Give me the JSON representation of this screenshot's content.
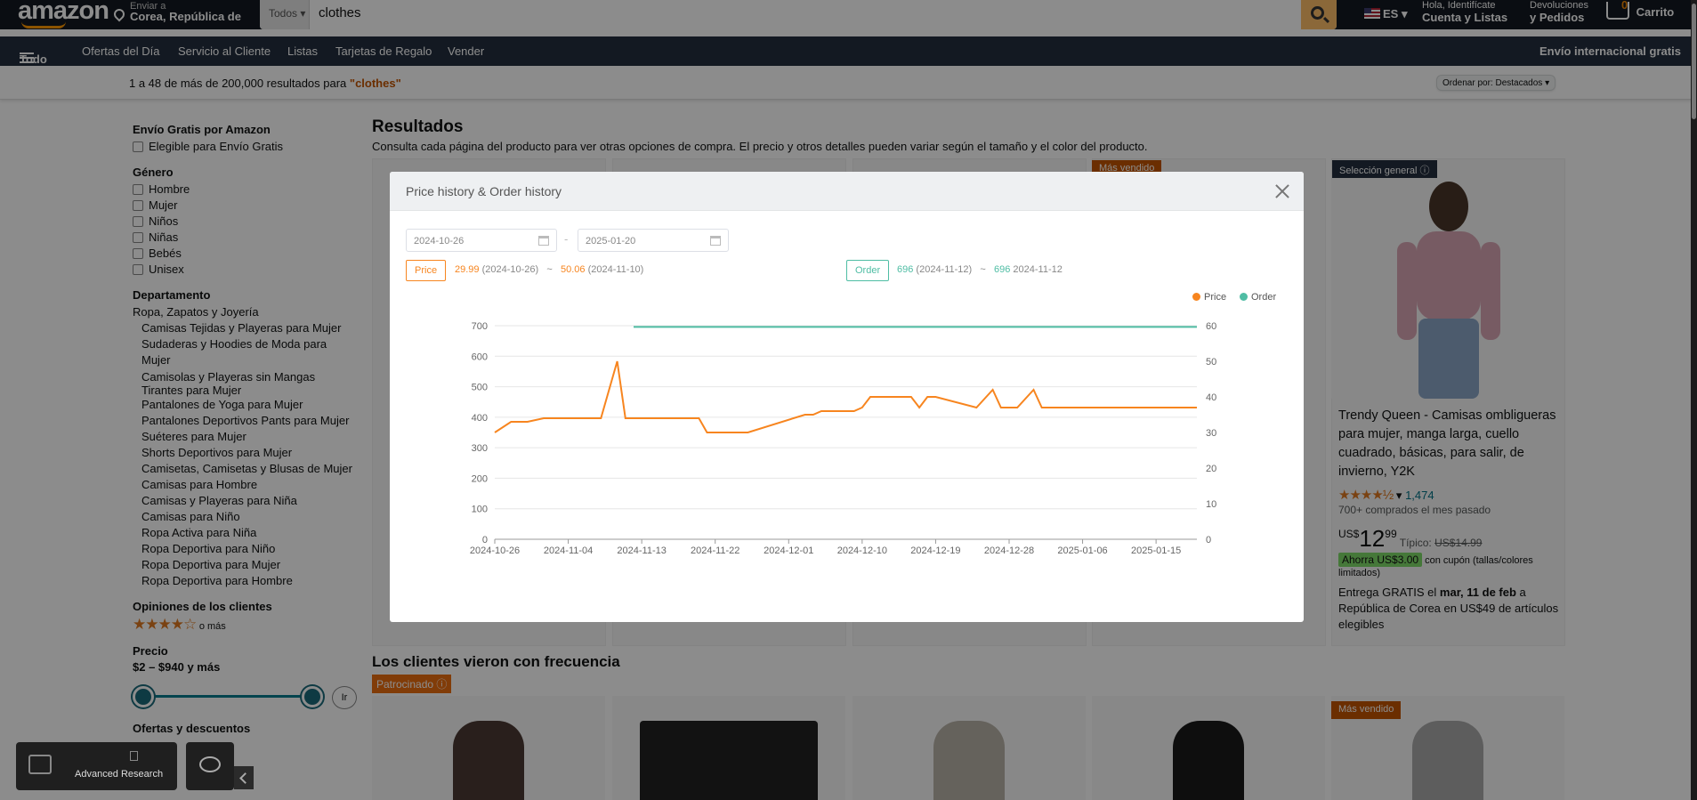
{
  "header": {
    "logo": "amazon",
    "deliver_line1": "Enviar a",
    "deliver_line2": "Corea, República de",
    "search_category": "Todos",
    "search_query": "clothes",
    "lang": "ES",
    "account_line1": "Hola, Identifícate",
    "account_line2": "Cuenta y Listas",
    "returns_line1": "Devoluciones",
    "returns_line2": "y Pedidos",
    "cart_count": "0",
    "cart_label": "Carrito"
  },
  "nav": {
    "all": "Todo",
    "items": [
      "Ofertas del Día",
      "Servicio al Cliente",
      "Listas",
      "Tarjetas de Regalo",
      "Vender"
    ],
    "promo": "Envío internacional gratis"
  },
  "results_bar": {
    "prefix": "1 a 48 de más de 200,000 resultados para ",
    "query": "\"clothes\"",
    "sort_label": "Ordenar por:",
    "sort_value": "Destacados"
  },
  "sidebar": {
    "free_shipping_title": "Envío Gratis por Amazon",
    "free_shipping_option": "Elegible para Envío Gratis",
    "gender_title": "Género",
    "genders": [
      "Hombre",
      "Mujer",
      "Niños",
      "Niñas",
      "Bebés",
      "Unisex"
    ],
    "department_title": "Departamento",
    "department_root": "Ropa, Zapatos y Joyería",
    "departments": [
      "Camisas Tejidas y Playeras para Mujer",
      "Sudaderas y Hoodies de Moda para Mujer",
      "Camisolas y Playeras sin Mangas Tirantes para Mujer",
      "Pantalones de Yoga para Mujer",
      "Pantalones Deportivos Pants para Mujer",
      "Suéteres para Mujer",
      "Shorts Deportivos para Mujer",
      "Camisetas, Camisetas y Blusas de Mujer",
      "Camisas para Hombre",
      "Camisas y Playeras para Niña",
      "Camisas para Niño",
      "Ropa Activa para Niña",
      "Ropa Deportiva para Niño",
      "Ropa Deportiva para Mujer",
      "Ropa Deportiva para Hombre"
    ],
    "reviews_title": "Opiniones de los clientes",
    "reviews_stars": "★★★★☆",
    "reviews_suffix": "o más",
    "price_title": "Precio",
    "price_range": "$2 – $940 y más",
    "price_go": "Ir",
    "deals_title": "Ofertas y descuentos"
  },
  "main": {
    "title": "Resultados",
    "subtitle": "Consulta cada página del producto para ver otras opciones de compra. El precio y otros detalles pueden variar según el tamaño y el color del producto.",
    "badge_bestseller": "Más vendido",
    "badge_overall": "Selección general",
    "product": {
      "title": "Trendy Queen - Camisas ombligueras para mujer, manga larga, cuello cuadrado, básicas, para salir, de invierno, Y2K",
      "stars": "★★★★½",
      "rating_count": "1,474",
      "bought": "700+ comprados el mes pasado",
      "currency": "US$",
      "price_whole": "12",
      "price_frac": "99",
      "typical_label": "Típico:",
      "typical_price": "US$14.99",
      "coupon": "Ahorra US$3.00",
      "coupon_suffix": "con cupón (tallas/colores limitados)",
      "delivery_prefix": "Entrega GRATIS el ",
      "delivery_date": "mar, 11 de feb",
      "delivery_suffix": " a República de Corea en US$49 de artículos elegibles"
    },
    "section2_title": "Los clientes vieron con frecuencia",
    "sponsored": "Patrocinado",
    "badge_bestseller2": "Más vendido"
  },
  "modal": {
    "title": "Price history & Order history",
    "date_from": "2024-10-26",
    "date_to": "2025-01-20",
    "date_sep": "-",
    "price_tag": "Price",
    "price_min": "29.99",
    "price_min_date": "(2024-10-26)",
    "price_max": "50.06",
    "price_max_date": "(2024-11-10)",
    "order_tag": "Order",
    "order_min": "696",
    "order_min_date": "(2024-11-12)",
    "order_max": "696",
    "order_max_date": "2024-11-12",
    "sep": "~",
    "legend_price": "Price",
    "legend_order": "Order",
    "colors": {
      "price": "#f7851f",
      "order": "#4fbda4"
    }
  },
  "chart_data": {
    "type": "line",
    "x_ticks": [
      "2024-10-26",
      "2024-11-04",
      "2024-11-13",
      "2024-11-22",
      "2024-12-01",
      "2024-12-10",
      "2024-12-19",
      "2024-12-28",
      "2025-01-06",
      "2025-01-15"
    ],
    "y_left_ticks": [
      0,
      100,
      200,
      300,
      400,
      500,
      600,
      700
    ],
    "y_right_ticks": [
      0,
      10,
      20,
      30,
      40,
      50,
      60
    ],
    "ylim_left": [
      0,
      700
    ],
    "ylim_right": [
      0,
      60
    ],
    "series": [
      {
        "name": "Price",
        "axis": "right",
        "x": [
          "2024-10-26",
          "2024-10-28",
          "2024-10-30",
          "2024-11-01",
          "2024-11-03",
          "2024-11-08",
          "2024-11-10",
          "2024-11-11",
          "2024-11-20",
          "2024-11-21",
          "2024-11-26",
          "2024-12-03",
          "2024-12-04",
          "2024-12-05",
          "2024-12-09",
          "2024-12-10",
          "2024-12-11",
          "2024-12-16",
          "2024-12-17",
          "2024-12-18",
          "2024-12-19",
          "2024-12-24",
          "2024-12-26",
          "2024-12-27",
          "2024-12-28",
          "2024-12-29",
          "2024-12-31",
          "2025-01-01",
          "2025-01-02",
          "2025-01-20"
        ],
        "values": [
          30,
          33,
          33,
          34,
          34,
          34,
          50,
          34,
          34,
          30,
          30,
          35,
          35,
          36,
          36,
          37,
          40,
          40,
          37,
          40,
          40,
          37,
          42,
          37,
          37,
          37,
          42,
          37,
          37,
          37
        ]
      },
      {
        "name": "Order",
        "axis": "left",
        "x": [
          "2024-11-12",
          "2025-01-20"
        ],
        "values": [
          696,
          696
        ]
      }
    ]
  }
}
